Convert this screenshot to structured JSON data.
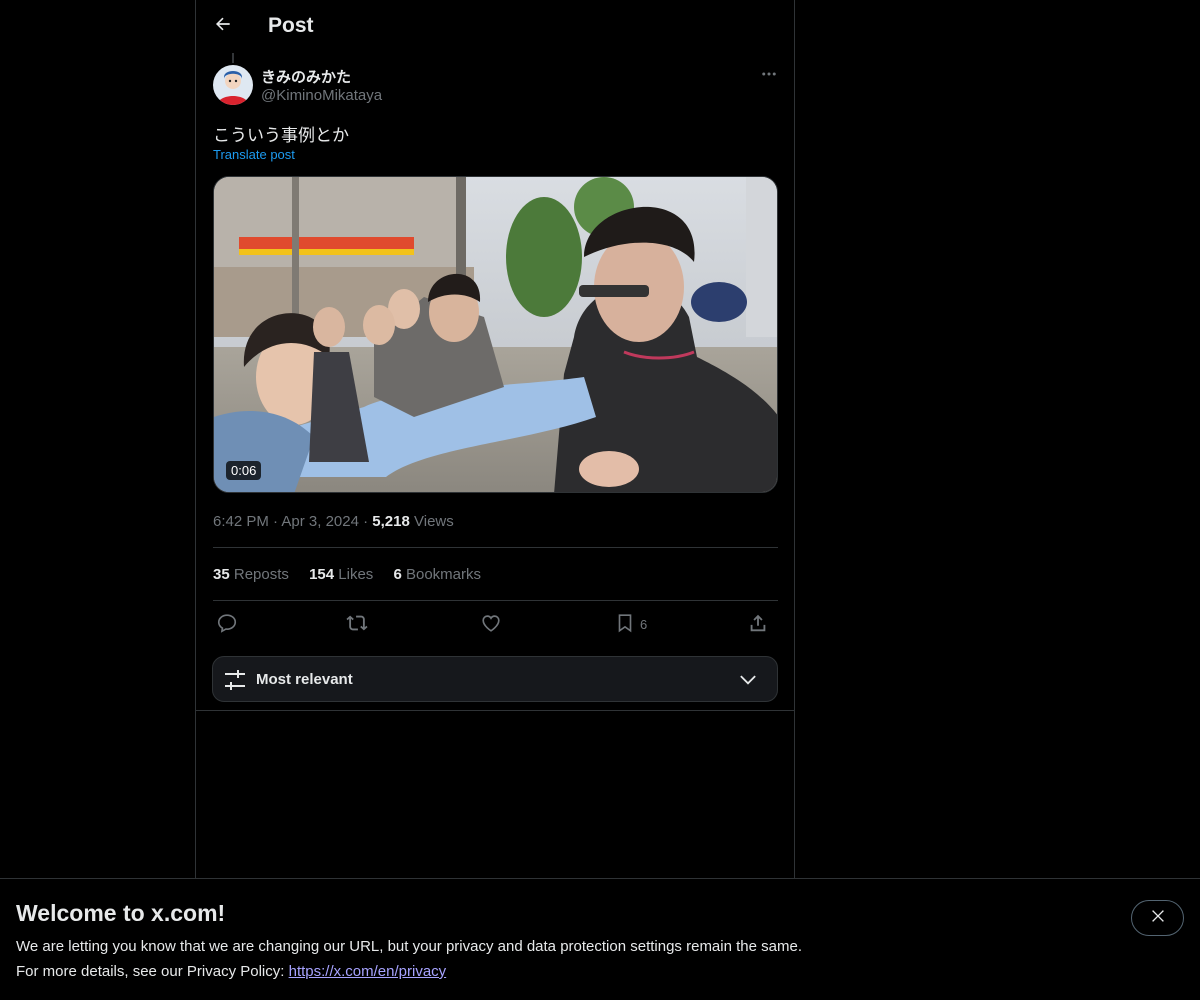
{
  "header": {
    "title": "Post"
  },
  "post": {
    "author_name": "きみのみかた",
    "author_handle": "@KiminoMikataya",
    "text": "こういう事例とか",
    "translate_label": "Translate post",
    "video_duration": "0:06",
    "time": "6:42 PM",
    "date": "Apr 3, 2024",
    "views_count": "5,218",
    "views_label": "Views",
    "separator": "·"
  },
  "stats": {
    "reposts_count": "35",
    "reposts_label": "Reposts",
    "likes_count": "154",
    "likes_label": "Likes",
    "bookmarks_count": "6",
    "bookmarks_label": "Bookmarks"
  },
  "actions": {
    "bookmark_count": "6"
  },
  "sort": {
    "label": "Most relevant"
  },
  "banner": {
    "title": "Welcome to x.com!",
    "line1": "We are letting you know that we are changing our URL, but your privacy and data protection settings remain the same.",
    "line2_prefix": "For more details, see our Privacy Policy:",
    "link_text": "https://x.com/en/privacy"
  },
  "icons": {
    "back": "arrow-left-icon",
    "more": "more-horizontal-icon",
    "reply": "reply-icon",
    "repost": "repost-icon",
    "like": "heart-icon",
    "bookmark": "bookmark-icon",
    "share": "share-icon",
    "sort": "sliders-icon",
    "chevron": "chevron-down-icon",
    "close": "close-icon"
  },
  "colors": {
    "accent": "#1d9bf0",
    "muted": "#71767b",
    "text": "#e7e9ea",
    "border": "#2f3336",
    "link": "#a7a3ff"
  }
}
